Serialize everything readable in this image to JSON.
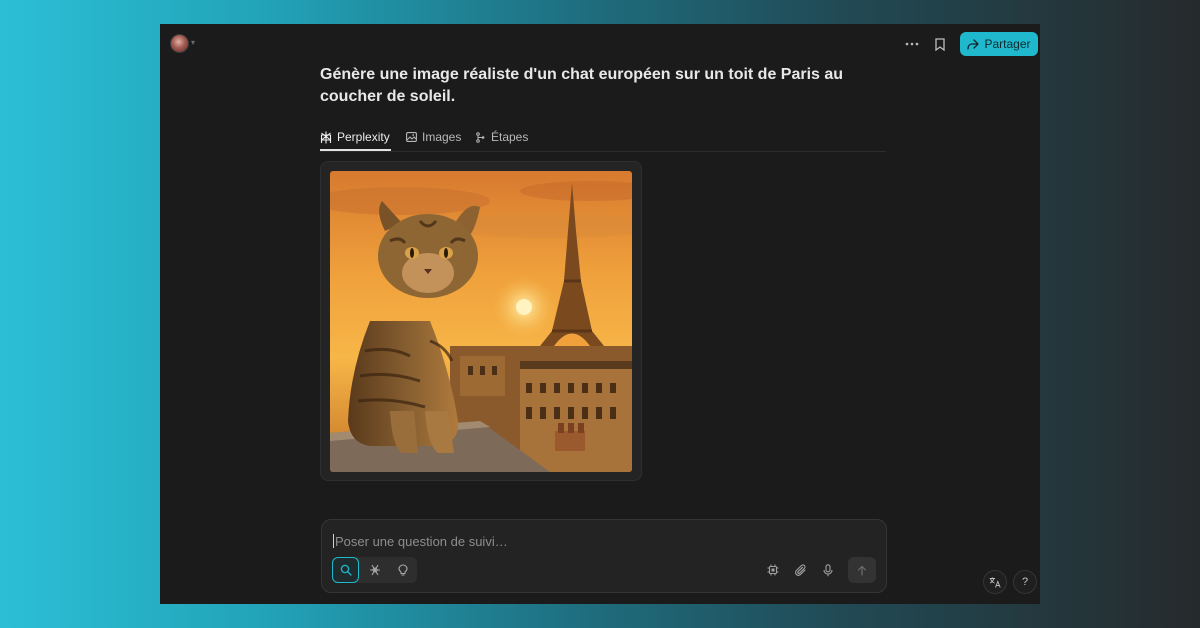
{
  "header": {
    "avatar_icon": "user-avatar",
    "more_icon": "ellipsis-icon",
    "bookmark_icon": "bookmark-icon",
    "share_label": "Partager",
    "accent_color": "#20b8cd"
  },
  "thread": {
    "query": "Génère une image réaliste d'un chat européen sur un toit de Paris au coucher de soleil."
  },
  "tabs": [
    {
      "label": "Perplexity",
      "icon": "perplexity-logo-icon",
      "active": true
    },
    {
      "label": "Images",
      "icon": "image-icon",
      "active": false
    },
    {
      "label": "Étapes",
      "icon": "steps-icon",
      "active": false
    }
  ],
  "result": {
    "image_subject": "chat tigré sur un toit de Paris, tour Eiffel au coucher de soleil"
  },
  "composer": {
    "placeholder": "Poser une question de suivi…",
    "modes": [
      "search-icon",
      "research-icon",
      "labs-bulb-icon"
    ],
    "tools": [
      "model-chip-icon",
      "attach-paperclip-icon",
      "microphone-icon"
    ],
    "submit_icon": "arrow-up-icon"
  },
  "floating": {
    "translate_icon": "translate-icon",
    "help_label": "?"
  }
}
